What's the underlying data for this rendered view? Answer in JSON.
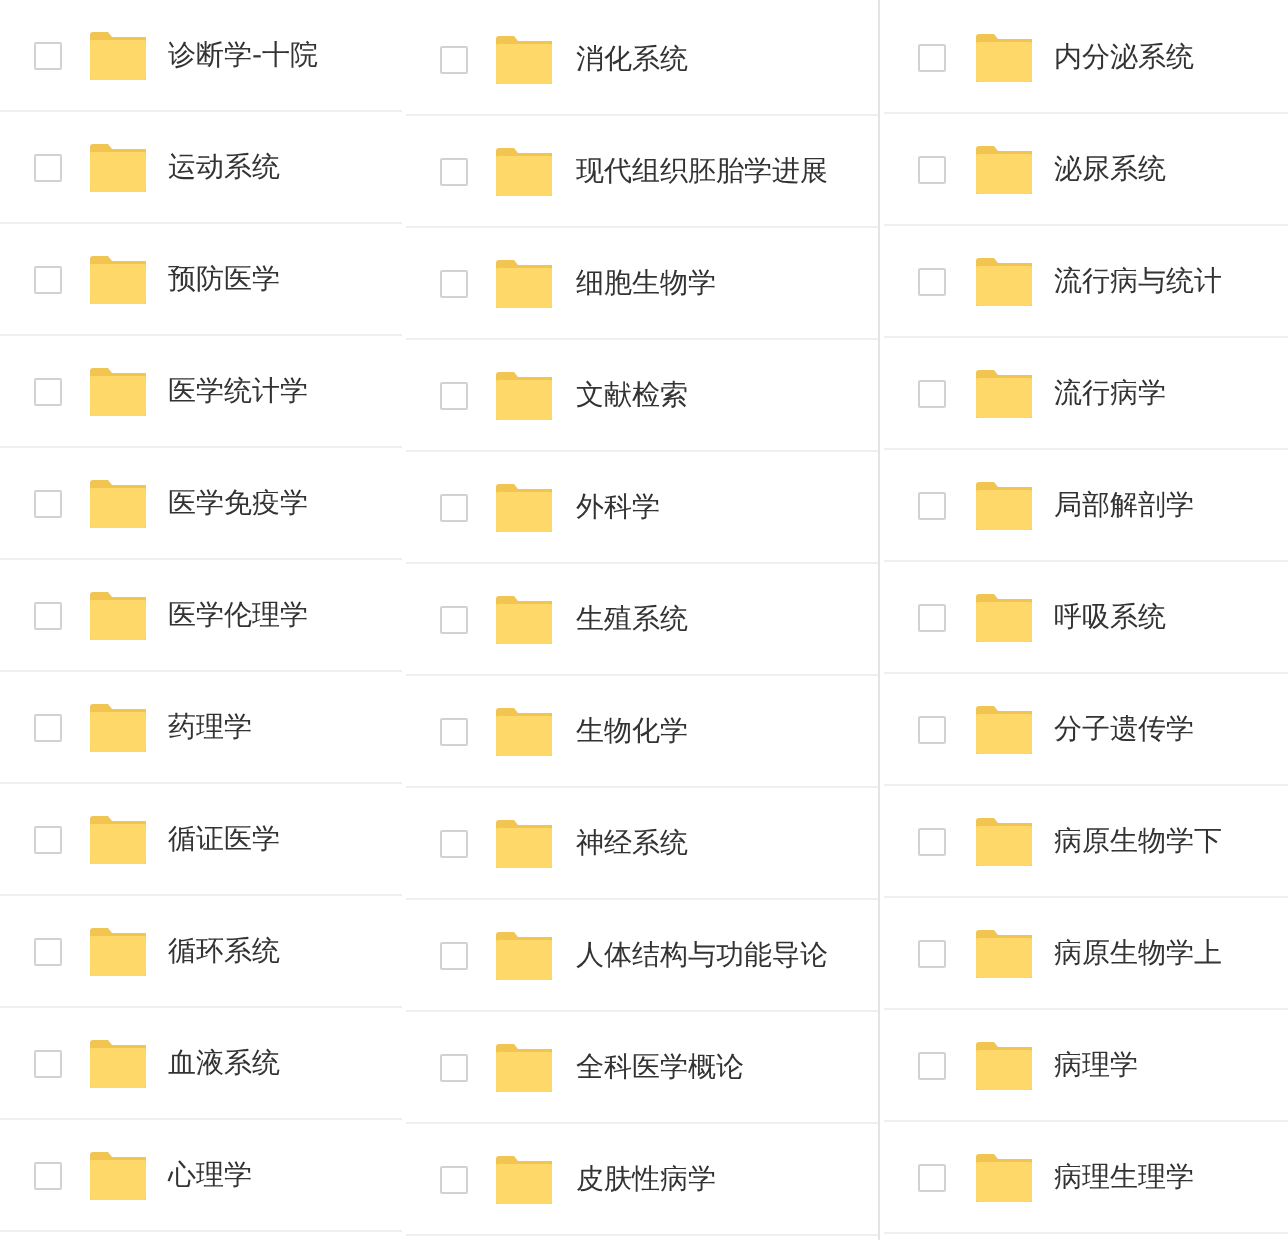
{
  "columns": [
    {
      "items": [
        {
          "name": "诊断学-十院",
          "checked": false
        },
        {
          "name": "运动系统",
          "checked": false
        },
        {
          "name": "预防医学",
          "checked": false
        },
        {
          "name": "医学统计学",
          "checked": false
        },
        {
          "name": "医学免疫学",
          "checked": false
        },
        {
          "name": "医学伦理学",
          "checked": false
        },
        {
          "name": "药理学",
          "checked": false
        },
        {
          "name": "循证医学",
          "checked": false
        },
        {
          "name": "循环系统",
          "checked": false
        },
        {
          "name": "血液系统",
          "checked": false
        },
        {
          "name": "心理学",
          "checked": false
        }
      ]
    },
    {
      "items": [
        {
          "name": "消化系统",
          "checked": false
        },
        {
          "name": "现代组织胚胎学进展",
          "checked": false
        },
        {
          "name": "细胞生物学",
          "checked": false
        },
        {
          "name": "文献检索",
          "checked": false
        },
        {
          "name": "外科学",
          "checked": false
        },
        {
          "name": "生殖系统",
          "checked": false
        },
        {
          "name": "生物化学",
          "checked": false
        },
        {
          "name": "神经系统",
          "checked": false
        },
        {
          "name": "人体结构与功能导论",
          "checked": false
        },
        {
          "name": "全科医学概论",
          "checked": false
        },
        {
          "name": "皮肤性病学",
          "checked": false
        }
      ]
    },
    {
      "items": [
        {
          "name": "内分泌系统",
          "checked": false
        },
        {
          "name": "泌尿系统",
          "checked": false
        },
        {
          "name": "流行病与统计",
          "checked": false
        },
        {
          "name": "流行病学",
          "checked": false
        },
        {
          "name": "局部解剖学",
          "checked": false
        },
        {
          "name": "呼吸系统",
          "checked": false
        },
        {
          "name": "分子遗传学",
          "checked": false
        },
        {
          "name": "病原生物学下",
          "checked": false
        },
        {
          "name": "病原生物学上",
          "checked": false
        },
        {
          "name": "病理学",
          "checked": false
        },
        {
          "name": "病理生理学",
          "checked": false
        }
      ]
    }
  ]
}
